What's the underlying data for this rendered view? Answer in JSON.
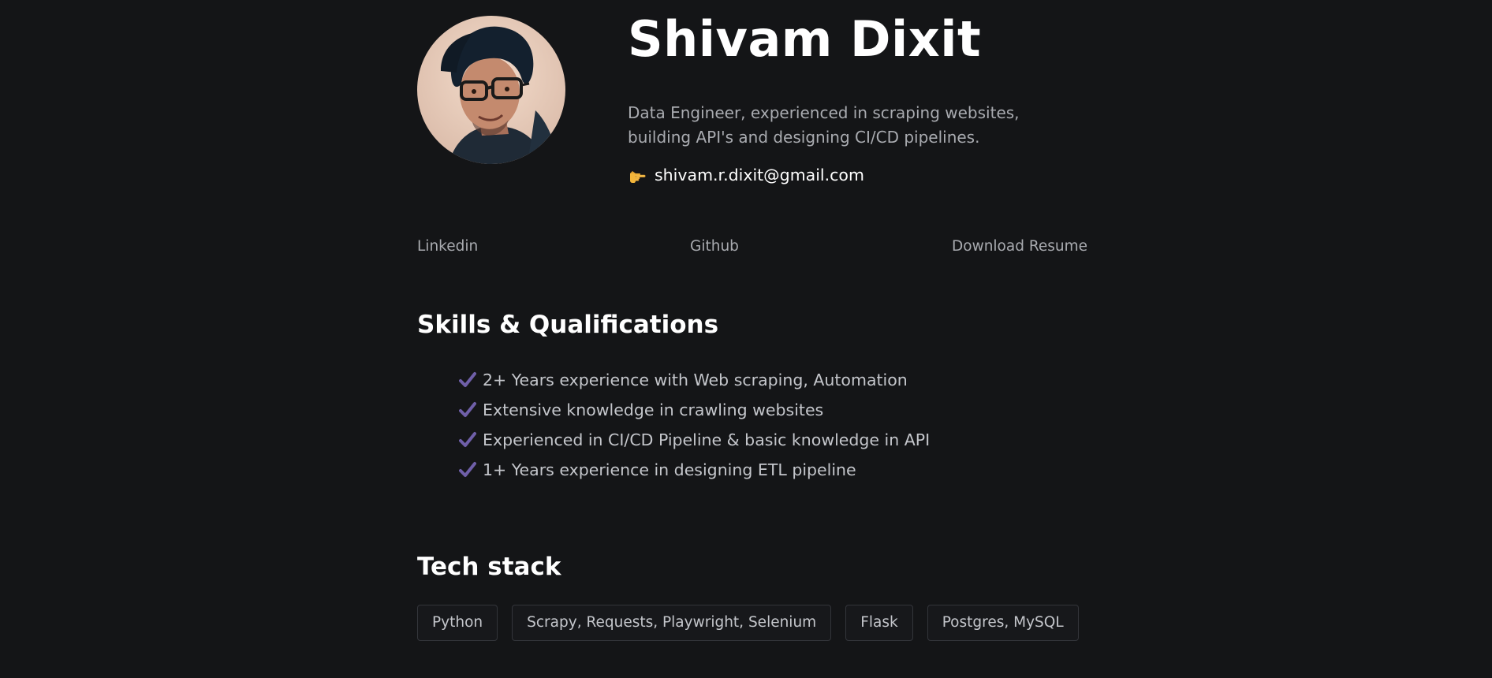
{
  "profile": {
    "name": "Shivam Dixit",
    "bio": "Data Engineer, experienced in scraping websites, building API's and designing CI/CD pipelines.",
    "email_icon": "pointing-hand-icon",
    "email": "shivam.r.dixit@gmail.com"
  },
  "links": {
    "linkedin": "Linkedin",
    "github": "Github",
    "resume": "Download Resume"
  },
  "skills": {
    "title": "Skills & Qualifications",
    "icon": "checkmark-icon",
    "accent_color": "#6f5fa8",
    "items": [
      "2+ Years experience with Web scraping, Automation",
      "Extensive knowledge in crawling websites",
      "Experienced in CI/CD Pipeline & basic knowledge in API",
      "1+ Years experience in designing ETL pipeline"
    ]
  },
  "tech_stack": {
    "title": "Tech stack",
    "items": [
      "Python",
      "Scrapy, Requests, Playwright, Selenium",
      "Flask",
      "Postgres, MySQL"
    ]
  },
  "colors": {
    "background": "#141517",
    "muted_text": "#a9abb0",
    "heading_text": "#ffffff"
  }
}
